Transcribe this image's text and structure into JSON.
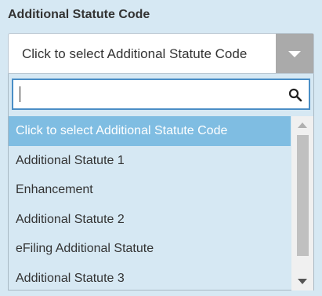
{
  "field": {
    "label": "Additional Statute Code",
    "selected_value": "Click to select Additional Statute Code"
  },
  "dropdown": {
    "search": {
      "value": "",
      "placeholder": ""
    },
    "items": [
      {
        "label": "Click to select Additional Statute Code",
        "selected": true
      },
      {
        "label": "Additional Statute 1",
        "selected": false
      },
      {
        "label": "Enhancement",
        "selected": false
      },
      {
        "label": "Additional Statute 2",
        "selected": false
      },
      {
        "label": "eFiling Additional Statute",
        "selected": false
      },
      {
        "label": "Additional Statute 3",
        "selected": false
      }
    ]
  },
  "icons": {
    "arrow": "chevron-down-icon",
    "search": "search-icon",
    "scroll_up": "scroll-up-icon",
    "scroll_down": "scroll-down-icon"
  },
  "colors": {
    "background": "#d6e8f3",
    "highlight": "#7fbde2",
    "focus_border": "#4a8ec6"
  }
}
